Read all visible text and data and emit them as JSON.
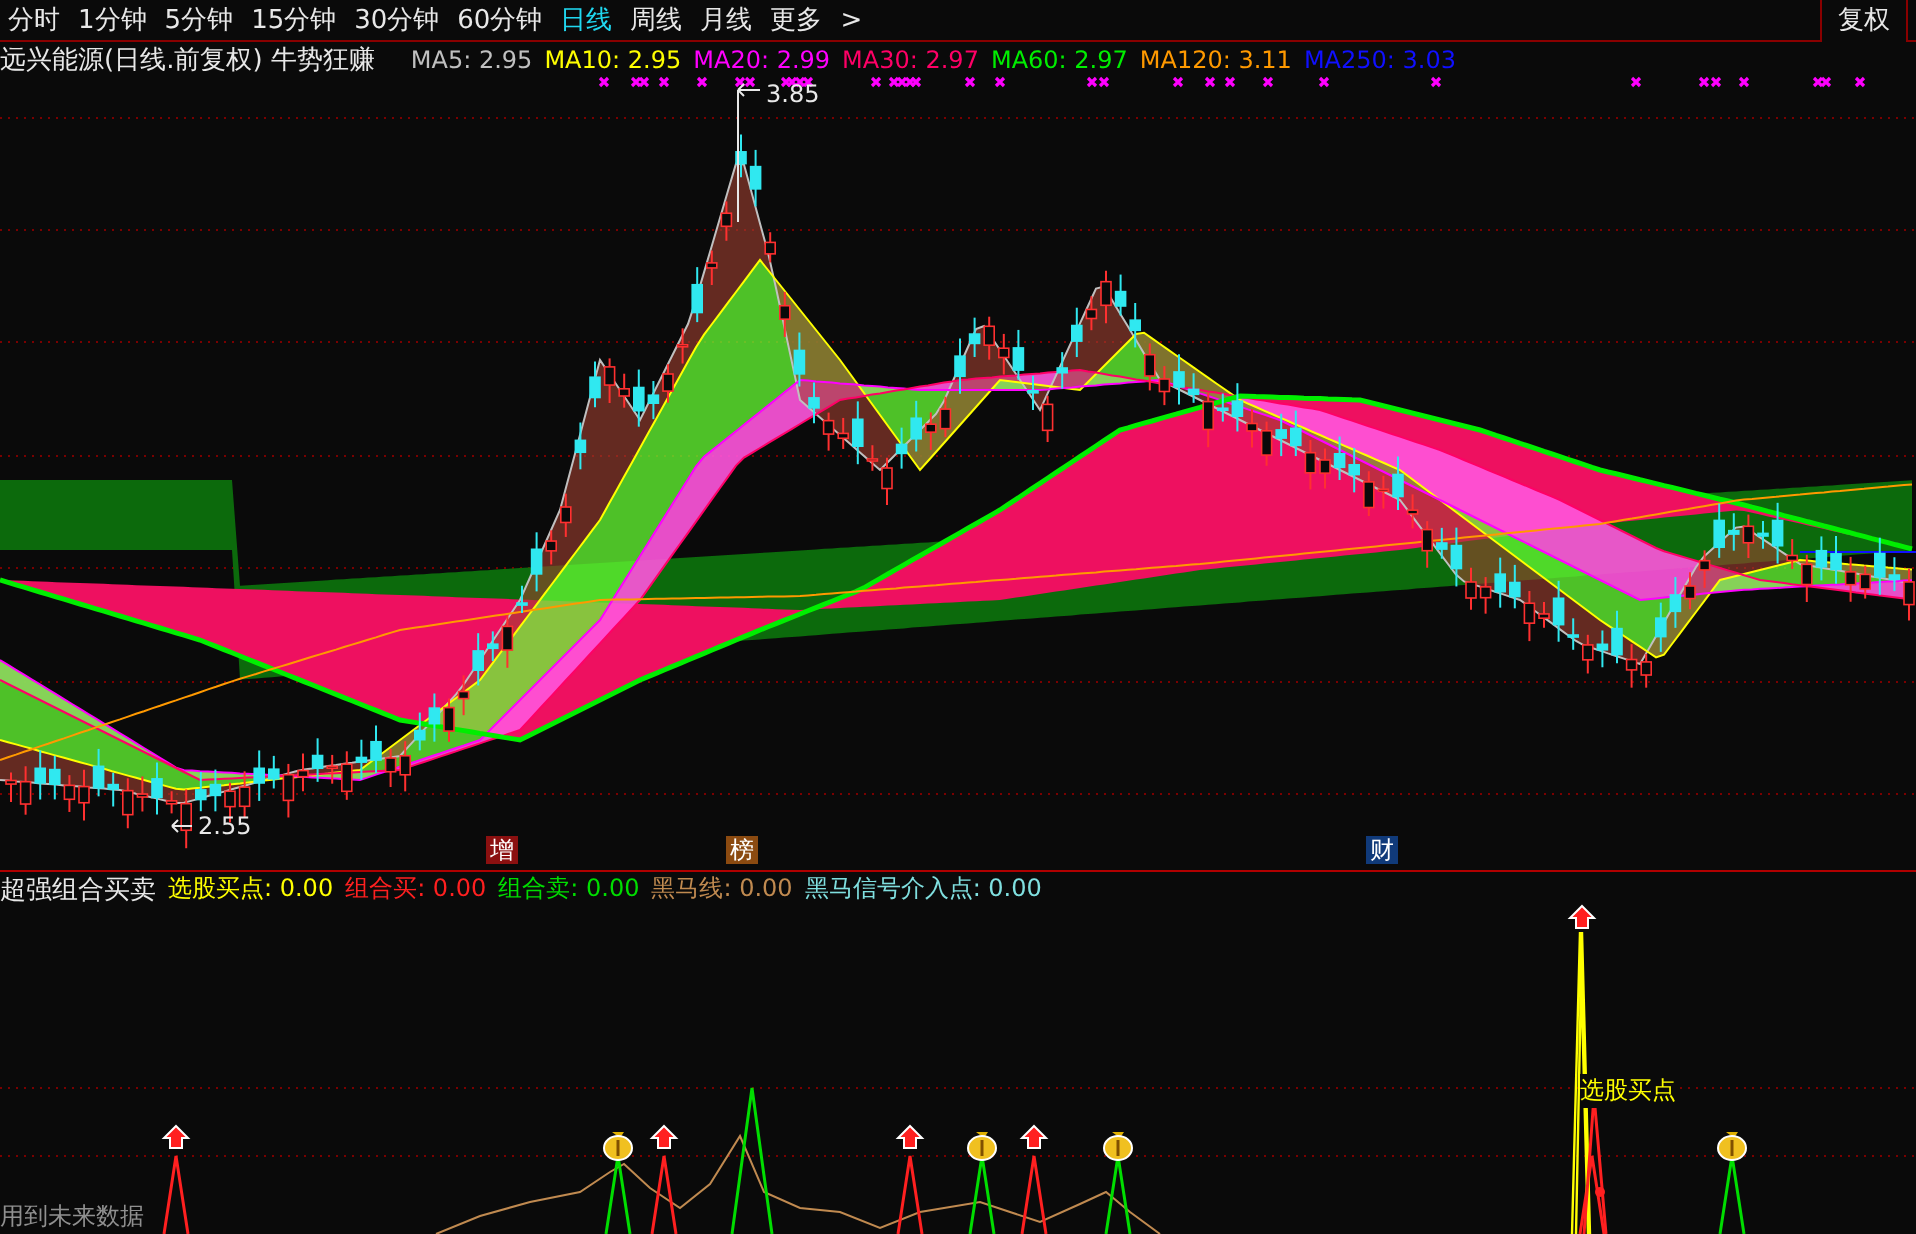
{
  "toolbar": {
    "periods": [
      {
        "label": "分时",
        "selected": false
      },
      {
        "label": "1分钟",
        "selected": false
      },
      {
        "label": "5分钟",
        "selected": false
      },
      {
        "label": "15分钟",
        "selected": false
      },
      {
        "label": "30分钟",
        "selected": false
      },
      {
        "label": "60分钟",
        "selected": false
      },
      {
        "label": "日线",
        "selected": true
      },
      {
        "label": "周线",
        "selected": false
      },
      {
        "label": "月线",
        "selected": false
      }
    ],
    "more": {
      "label": "更多",
      "arrow": ">"
    },
    "restore_button": "复权"
  },
  "main_chart": {
    "title": "远兴能源(日线.前复权) 牛势狂赚",
    "moving_averages": [
      {
        "label": "MA5:",
        "value": "2.95",
        "color": "#c0c0c0"
      },
      {
        "label": "MA10:",
        "value": "2.95",
        "color": "#ffff00"
      },
      {
        "label": "MA20:",
        "value": "2.99",
        "color": "#ff00ff"
      },
      {
        "label": "MA30:",
        "value": "2.97",
        "color": "#ff0066"
      },
      {
        "label": "MA60:",
        "value": "2.97",
        "color": "#00ee00"
      },
      {
        "label": "MA120:",
        "value": "3.11",
        "color": "#ff9900"
      },
      {
        "label": "MA250:",
        "value": "3.03",
        "color": "#1010ff"
      }
    ],
    "high_label": "3.85",
    "low_label": "2.55",
    "event_markers": [
      {
        "label": "增",
        "color": "#8b1010"
      },
      {
        "label": "榜",
        "color": "#8b4a10"
      },
      {
        "label": "财",
        "color": "#103a7a"
      }
    ]
  },
  "indicator": {
    "title": "超强组合买卖",
    "values": [
      {
        "label": "选股买点:",
        "value": "0.00",
        "color": "#ffff00"
      },
      {
        "label": "组合买:",
        "value": "0.00",
        "color": "#ff2020"
      },
      {
        "label": "组合卖:",
        "value": "0.00",
        "color": "#00dd00"
      },
      {
        "label": "黑马线:",
        "value": "0.00",
        "color": "#c08a50"
      },
      {
        "label": "黑马信号介入点:",
        "value": "0.00",
        "color": "#80e0e0"
      }
    ],
    "annotation": "选股买点",
    "footnote": "用到未来数据"
  }
}
